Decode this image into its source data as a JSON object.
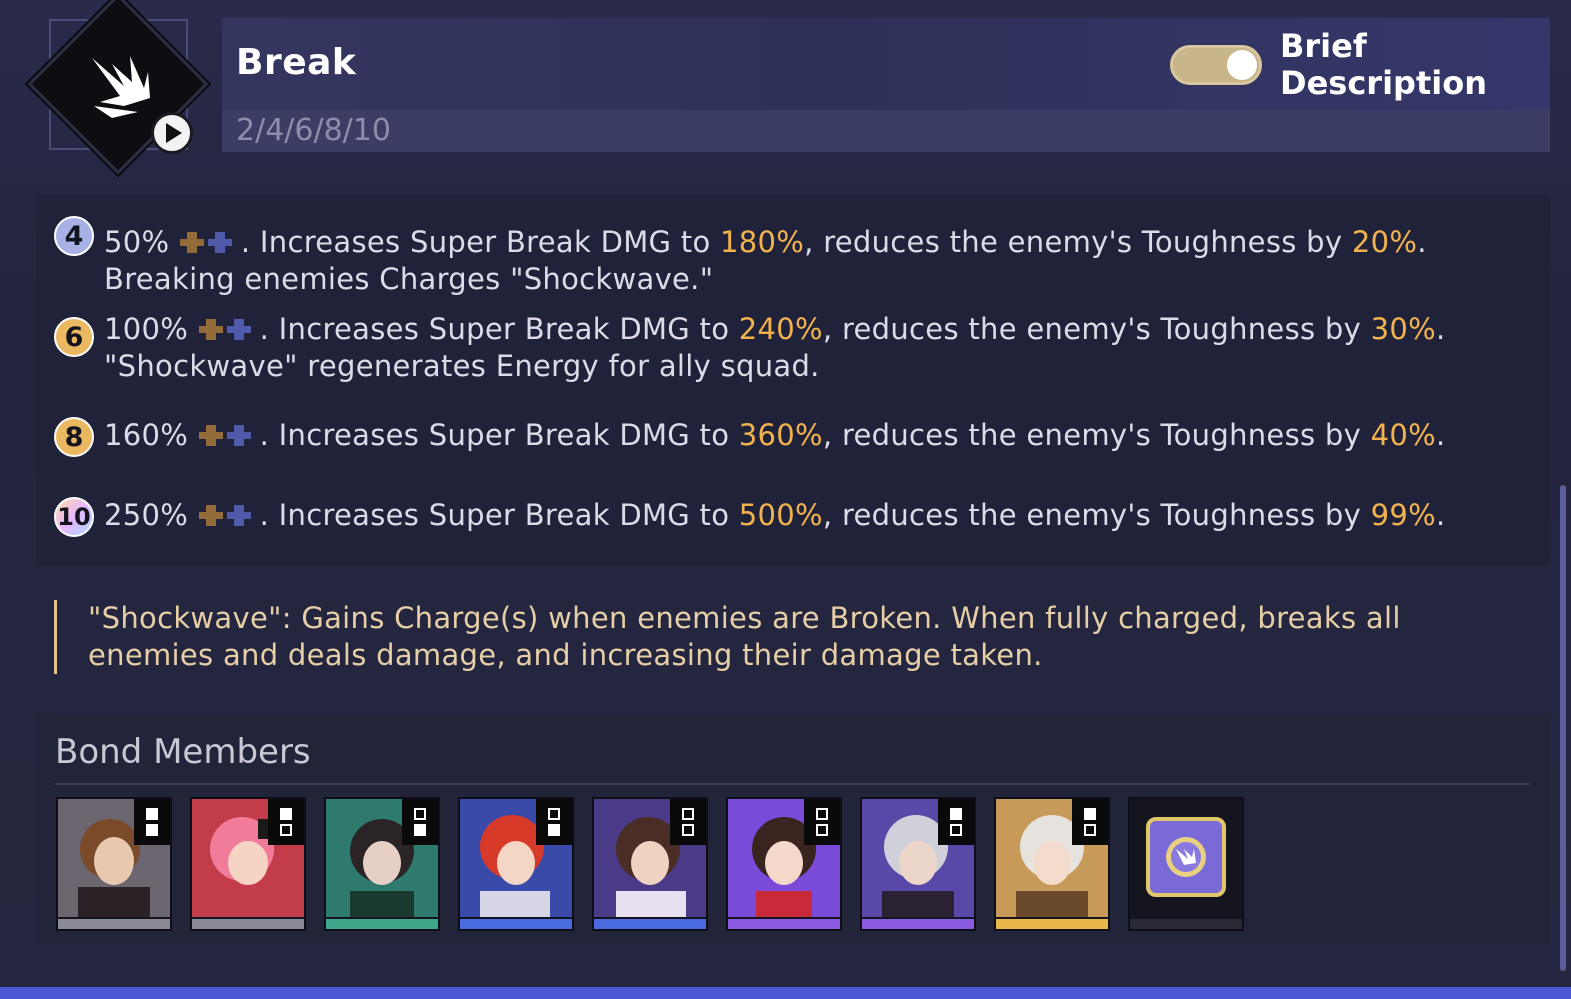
{
  "header": {
    "title": "Break",
    "levels": "2/4/6/8/10",
    "toggle_label_line1": "Brief",
    "toggle_label_line2": "Description",
    "toggle_on": true
  },
  "effects": [
    {
      "badge": "4",
      "line1_a": "50%",
      "line1_b": ". Increases Super Break DMG to ",
      "v1": "180%",
      "line1_c": ", reduces the enemy's Toughness by ",
      "v2": "20%",
      "line1_d": ".",
      "line2": "Breaking enemies Charges \"Shockwave.\""
    },
    {
      "badge": "6",
      "line1_a": "100%",
      "line1_b": ". Increases Super Break DMG to ",
      "v1": "240%",
      "line1_c": ", reduces the enemy's Toughness by ",
      "v2": "30%",
      "line1_d": ".",
      "line2": "\"Shockwave\" regenerates Energy for ally squad."
    },
    {
      "badge": "8",
      "line1_a": "160%",
      "line1_b": ". Increases Super Break DMG to ",
      "v1": "360%",
      "line1_c": ", reduces the enemy's Toughness by ",
      "v2": "40%",
      "line1_d": ".",
      "line2": ""
    },
    {
      "badge": "10",
      "line1_a": "250%",
      "line1_b": ". Increases Super Break DMG to ",
      "v1": "500%",
      "line1_c": ", reduces the enemy's Toughness by ",
      "v2": "99%",
      "line1_d": ".",
      "line2": ""
    }
  ],
  "note": {
    "line1": "\"Shockwave\": Gains Charge(s) when enemies are Broken. When fully charged, breaks all",
    "line2": "enemies and deals damage, and increasing their damage taken."
  },
  "bond": {
    "title": "Bond Members",
    "members": [
      {
        "icon": "character-portrait-icon",
        "rarity_color": "#8a8a96"
      },
      {
        "icon": "character-portrait-icon",
        "rarity_color": "#8a8a96"
      },
      {
        "icon": "character-portrait-icon",
        "rarity_color": "#3fa88a"
      },
      {
        "icon": "character-portrait-icon",
        "rarity_color": "#4a6ae0"
      },
      {
        "icon": "character-portrait-icon",
        "rarity_color": "#4a6ae0"
      },
      {
        "icon": "character-portrait-icon",
        "rarity_color": "#8a5ae0"
      },
      {
        "icon": "character-portrait-icon",
        "rarity_color": "#8a5ae0"
      },
      {
        "icon": "character-portrait-icon",
        "rarity_color": "#e8b84a"
      },
      {
        "icon": "bond-emblem-icon",
        "rarity_color": "#2a2a36"
      }
    ]
  },
  "colors": {
    "highlight": "#f2b34e",
    "accent_bar": "#4c58d6",
    "note_text": "#e6cfa6"
  }
}
